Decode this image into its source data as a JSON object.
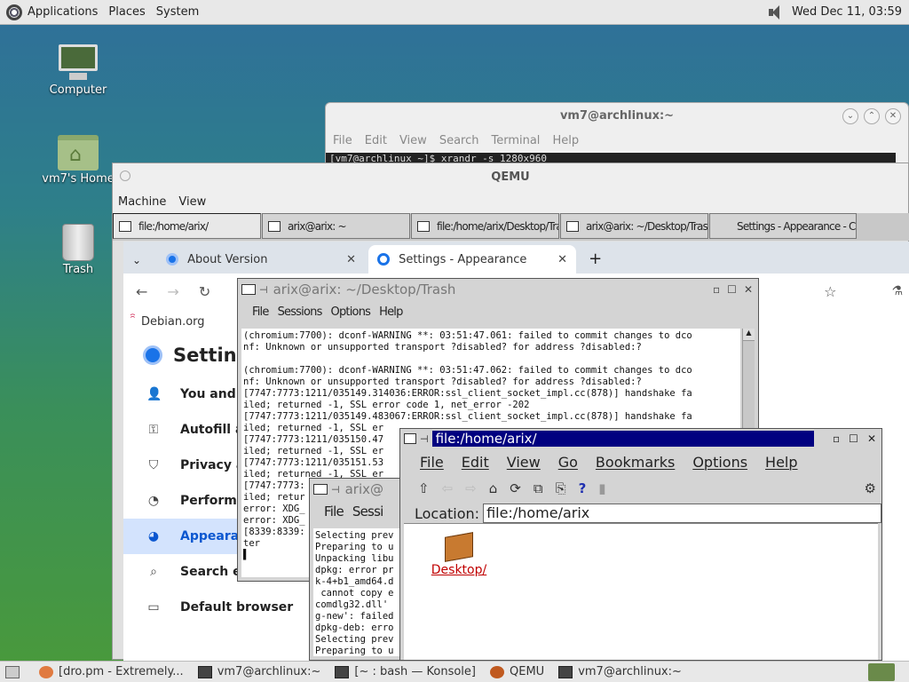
{
  "top_panel": {
    "menus": [
      "Applications",
      "Places",
      "System"
    ],
    "clock": "Wed Dec 11, 03:59"
  },
  "desktop_icons": [
    {
      "label": "Computer"
    },
    {
      "label": "vm7's Home"
    },
    {
      "label": "Trash"
    }
  ],
  "terminal_window": {
    "title": "vm7@archlinux:~",
    "menu": [
      "File",
      "Edit",
      "View",
      "Search",
      "Terminal",
      "Help"
    ],
    "first_line": "[vm7@archlinux ~]$ xrandr -s 1280x960"
  },
  "qemu": {
    "title": "QEMU",
    "menu": [
      "Machine",
      "View"
    ],
    "tasks": [
      "file:/home/arix/",
      "arix@arix: ~",
      "file:/home/arix/Desktop/Trash/",
      "arix@arix: ~/Desktop/Trash",
      "Settings - Appearance - Chromi..."
    ]
  },
  "chrome": {
    "tabs": [
      {
        "label": "About Version"
      },
      {
        "label": "Settings - Appearance"
      }
    ],
    "new_tab": "+",
    "bookmark": "Debian.org",
    "settings_title": "Settin",
    "sidebar": [
      {
        "label": "You and G",
        "icon": "person-icon"
      },
      {
        "label": "Autofill ar",
        "icon": "key-icon"
      },
      {
        "label": "Privacy ar",
        "icon": "shield-icon"
      },
      {
        "label": "Performan",
        "icon": "speedometer-icon"
      },
      {
        "label": "Appearan",
        "icon": "palette-icon"
      },
      {
        "label": "Search engine",
        "icon": "search-icon"
      },
      {
        "label": "Default browser",
        "icon": "browser-icon"
      }
    ]
  },
  "xterm1": {
    "title": "arix@arix: ~/Desktop/Trash",
    "menu": [
      "File",
      "Sessions",
      "Options",
      "Help"
    ],
    "lines": [
      "(chromium:7700): dconf-WARNING **: 03:51:47.061: failed to commit changes to dco",
      "nf: Unknown or unsupported transport ?disabled? for address ?disabled:?",
      "",
      "(chromium:7700): dconf-WARNING **: 03:51:47.062: failed to commit changes to dco",
      "nf: Unknown or unsupported transport ?disabled? for address ?disabled:?",
      "[7747:7773:1211/035149.314036:ERROR:ssl_client_socket_impl.cc(878)] handshake fa",
      "iled; returned -1, SSL error code 1, net_error -202",
      "[7747:7773:1211/035149.483067:ERROR:ssl_client_socket_impl.cc(878)] handshake fa",
      "iled; returned -1, SSL er",
      "[7747:7773:1211/035150.47",
      "iled; returned -1, SSL er",
      "[7747:7773:1211/035151.53",
      "iled; returned -1, SSL er",
      "[7747:7773:",
      "iled; retur",
      "error: XDG_",
      "error: XDG_",
      "[8339:8339:",
      "ter"
    ]
  },
  "xterm2": {
    "title": "arix@",
    "menu": [
      "File",
      "Sessi"
    ],
    "lines": [
      "Selecting prev",
      "Preparing to u",
      "Unpacking libu",
      "dpkg: error pr",
      "k-4+b1_amd64.d",
      " cannot copy e",
      "comdlg32.dll'",
      "g-new': failed",
      "dpkg-deb: erro",
      "Selecting prev",
      "Preparing to u"
    ]
  },
  "konqueror": {
    "title": "file:/home/arix/",
    "menu": [
      "File",
      "Edit",
      "View",
      "Go",
      "Bookmarks",
      "Options",
      "Help"
    ],
    "location_label": "Location:",
    "location_value": "file:/home/arix",
    "items": [
      {
        "label": "Desktop/"
      }
    ]
  },
  "bottom_taskbar": [
    {
      "label": "[dro.pm - Extremely..."
    },
    {
      "label": "vm7@archlinux:~"
    },
    {
      "label": "[~ : bash — Konsole]"
    },
    {
      "label": "QEMU"
    },
    {
      "label": "vm7@archlinux:~"
    }
  ]
}
